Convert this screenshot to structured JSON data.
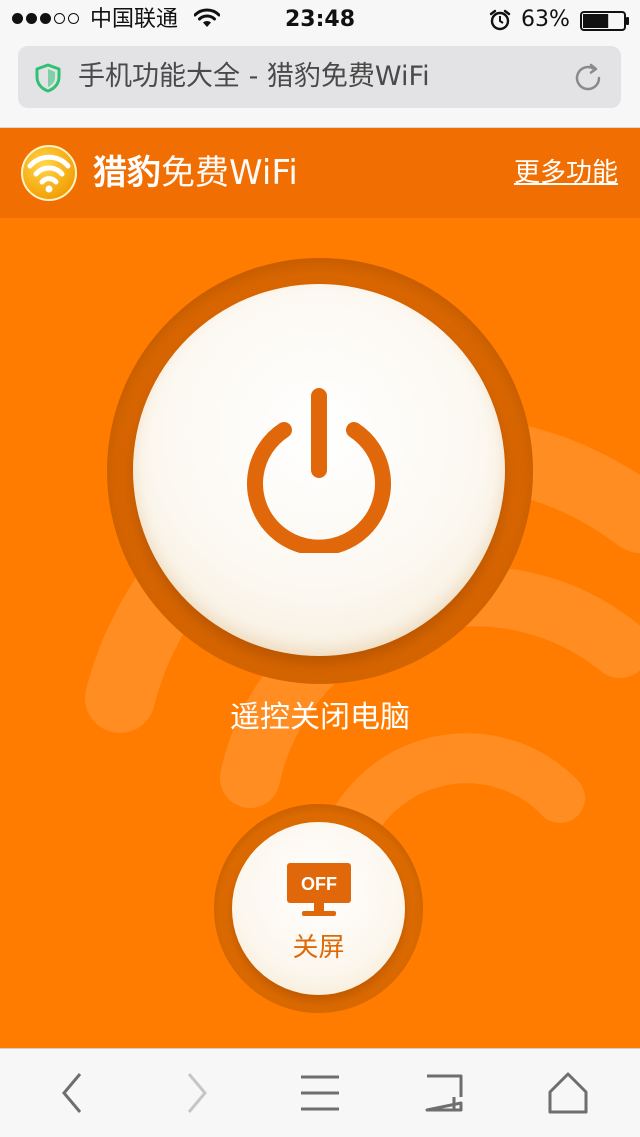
{
  "status_bar": {
    "carrier": "中国联通",
    "time": "23:48",
    "battery": "63%",
    "battery_level": 0.63
  },
  "address_bar": {
    "title": "手机功能大全 - 猎豹免费WiFi"
  },
  "header": {
    "brand_bold": "猎豹",
    "brand_light": "免费WiFi",
    "more_link": "更多功能"
  },
  "main": {
    "power_label": "遥控关闭电脑",
    "screen_icon_text": "OFF",
    "screen_label": "关屏"
  },
  "colors": {
    "accent": "#ff7c00",
    "header": "#f06e02",
    "icon_orange": "#e0670a"
  },
  "toolbar": {
    "items": [
      "back-icon",
      "forward-icon",
      "menu-icon",
      "tabs-icon",
      "home-icon"
    ]
  }
}
